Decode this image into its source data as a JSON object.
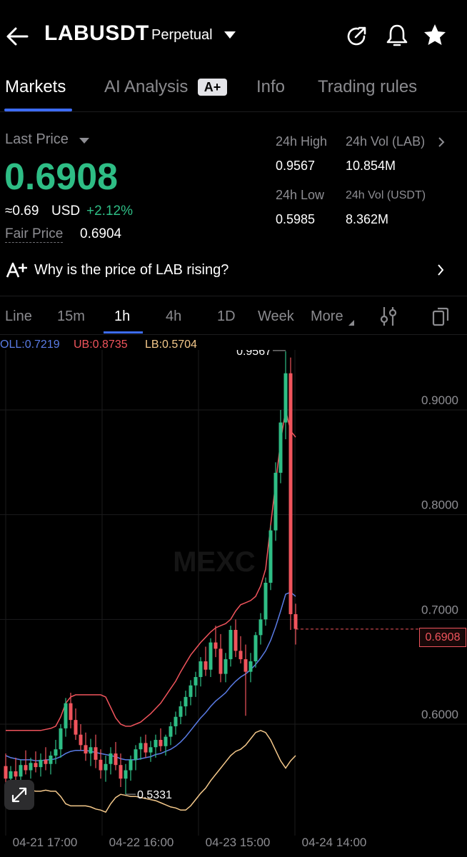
{
  "header": {
    "symbol": "LABUSDT",
    "contract_type": "Perpetual"
  },
  "tabs": [
    {
      "label": "Markets"
    },
    {
      "label": "AI Analysis"
    },
    {
      "label": "Info"
    },
    {
      "label": "Trading rules"
    }
  ],
  "ai_badge": "A+",
  "ticker": {
    "last_price_label": "Last Price",
    "last_price": "0.6908",
    "usd_approx": "≈0.69",
    "usd_unit": "USD",
    "change_pct": "+2.12%",
    "fair_price_label": "Fair Price",
    "fair_price": "0.6904",
    "high_label": "24h High",
    "high": "0.9567",
    "low_label": "24h Low",
    "low": "0.5985",
    "vol_lab_label": "24h Vol (LAB)",
    "vol_lab": "10.854M",
    "vol_usdt_label": "24h Vol (USDT)",
    "vol_usdt": "8.362M"
  },
  "ai_question": "Why is the price of LAB rising?",
  "timeframes": [
    {
      "label": "Line"
    },
    {
      "label": "15m"
    },
    {
      "label": "1h"
    },
    {
      "label": "4h"
    },
    {
      "label": "1D"
    },
    {
      "label": "Week"
    },
    {
      "label": "More"
    }
  ],
  "indicators": {
    "boll": "OLL:0.7219",
    "ub": "UB:0.8735",
    "lb": "LB:0.5704"
  },
  "chart_data": {
    "type": "candlestick",
    "x_ticks": [
      "04-21 17:00",
      "04-22 16:00",
      "04-23 15:00",
      "04-24 14:00"
    ],
    "y_ticks": [
      "0.9000",
      "0.8000",
      "0.7000",
      "0.6000"
    ],
    "ylim": [
      0.5,
      0.97
    ],
    "current_price": "0.6908",
    "max_label": "0.9567",
    "min_label": "0.5331",
    "watermark": "MEXC",
    "candles": [
      {
        "o": 0.56,
        "h": 0.572,
        "l": 0.542,
        "c": 0.548
      },
      {
        "o": 0.548,
        "h": 0.56,
        "l": 0.534,
        "c": 0.555
      },
      {
        "o": 0.555,
        "h": 0.568,
        "l": 0.545,
        "c": 0.55
      },
      {
        "o": 0.55,
        "h": 0.566,
        "l": 0.544,
        "c": 0.561
      },
      {
        "o": 0.561,
        "h": 0.575,
        "l": 0.552,
        "c": 0.556
      },
      {
        "o": 0.556,
        "h": 0.568,
        "l": 0.548,
        "c": 0.563
      },
      {
        "o": 0.563,
        "h": 0.574,
        "l": 0.554,
        "c": 0.559
      },
      {
        "o": 0.559,
        "h": 0.572,
        "l": 0.55,
        "c": 0.566
      },
      {
        "o": 0.566,
        "h": 0.578,
        "l": 0.556,
        "c": 0.562
      },
      {
        "o": 0.562,
        "h": 0.574,
        "l": 0.552,
        "c": 0.57
      },
      {
        "o": 0.57,
        "h": 0.585,
        "l": 0.562,
        "c": 0.576
      },
      {
        "o": 0.576,
        "h": 0.6,
        "l": 0.568,
        "c": 0.596
      },
      {
        "o": 0.596,
        "h": 0.625,
        "l": 0.588,
        "c": 0.62
      },
      {
        "o": 0.62,
        "h": 0.63,
        "l": 0.596,
        "c": 0.604
      },
      {
        "o": 0.604,
        "h": 0.615,
        "l": 0.585,
        "c": 0.59
      },
      {
        "o": 0.59,
        "h": 0.6,
        "l": 0.575,
        "c": 0.58
      },
      {
        "o": 0.58,
        "h": 0.592,
        "l": 0.565,
        "c": 0.572
      },
      {
        "o": 0.572,
        "h": 0.586,
        "l": 0.56,
        "c": 0.578
      },
      {
        "o": 0.578,
        "h": 0.59,
        "l": 0.558,
        "c": 0.566
      },
      {
        "o": 0.566,
        "h": 0.576,
        "l": 0.548,
        "c": 0.556
      },
      {
        "o": 0.556,
        "h": 0.57,
        "l": 0.545,
        "c": 0.562
      },
      {
        "o": 0.562,
        "h": 0.578,
        "l": 0.552,
        "c": 0.572
      },
      {
        "o": 0.572,
        "h": 0.583,
        "l": 0.556,
        "c": 0.561
      },
      {
        "o": 0.561,
        "h": 0.572,
        "l": 0.54,
        "c": 0.548
      },
      {
        "o": 0.548,
        "h": 0.562,
        "l": 0.533,
        "c": 0.556
      },
      {
        "o": 0.556,
        "h": 0.57,
        "l": 0.546,
        "c": 0.566
      },
      {
        "o": 0.566,
        "h": 0.58,
        "l": 0.556,
        "c": 0.576
      },
      {
        "o": 0.576,
        "h": 0.588,
        "l": 0.566,
        "c": 0.582
      },
      {
        "o": 0.582,
        "h": 0.59,
        "l": 0.568,
        "c": 0.573
      },
      {
        "o": 0.573,
        "h": 0.584,
        "l": 0.564,
        "c": 0.578
      },
      {
        "o": 0.578,
        "h": 0.59,
        "l": 0.568,
        "c": 0.585
      },
      {
        "o": 0.585,
        "h": 0.596,
        "l": 0.574,
        "c": 0.579
      },
      {
        "o": 0.579,
        "h": 0.59,
        "l": 0.57,
        "c": 0.588
      },
      {
        "o": 0.588,
        "h": 0.602,
        "l": 0.58,
        "c": 0.598
      },
      {
        "o": 0.598,
        "h": 0.612,
        "l": 0.59,
        "c": 0.607
      },
      {
        "o": 0.607,
        "h": 0.622,
        "l": 0.6,
        "c": 0.617
      },
      {
        "o": 0.617,
        "h": 0.632,
        "l": 0.608,
        "c": 0.626
      },
      {
        "o": 0.626,
        "h": 0.642,
        "l": 0.618,
        "c": 0.637
      },
      {
        "o": 0.637,
        "h": 0.65,
        "l": 0.626,
        "c": 0.645
      },
      {
        "o": 0.645,
        "h": 0.664,
        "l": 0.636,
        "c": 0.66
      },
      {
        "o": 0.66,
        "h": 0.674,
        "l": 0.646,
        "c": 0.652
      },
      {
        "o": 0.652,
        "h": 0.682,
        "l": 0.645,
        "c": 0.678
      },
      {
        "o": 0.678,
        "h": 0.694,
        "l": 0.664,
        "c": 0.672
      },
      {
        "o": 0.672,
        "h": 0.686,
        "l": 0.64,
        "c": 0.648
      },
      {
        "o": 0.648,
        "h": 0.668,
        "l": 0.64,
        "c": 0.662
      },
      {
        "o": 0.662,
        "h": 0.694,
        "l": 0.655,
        "c": 0.69
      },
      {
        "o": 0.69,
        "h": 0.7,
        "l": 0.664,
        "c": 0.67
      },
      {
        "o": 0.67,
        "h": 0.684,
        "l": 0.658,
        "c": 0.662
      },
      {
        "o": 0.662,
        "h": 0.676,
        "l": 0.608,
        "c": 0.65
      },
      {
        "o": 0.65,
        "h": 0.668,
        "l": 0.64,
        "c": 0.66
      },
      {
        "o": 0.66,
        "h": 0.688,
        "l": 0.654,
        "c": 0.685
      },
      {
        "o": 0.685,
        "h": 0.706,
        "l": 0.676,
        "c": 0.7
      },
      {
        "o": 0.7,
        "h": 0.74,
        "l": 0.694,
        "c": 0.735
      },
      {
        "o": 0.735,
        "h": 0.79,
        "l": 0.728,
        "c": 0.785
      },
      {
        "o": 0.785,
        "h": 0.85,
        "l": 0.775,
        "c": 0.84
      },
      {
        "o": 0.84,
        "h": 0.9,
        "l": 0.83,
        "c": 0.888
      },
      {
        "o": 0.888,
        "h": 0.956,
        "l": 0.872,
        "c": 0.935
      },
      {
        "o": 0.935,
        "h": 0.95,
        "l": 0.69,
        "c": 0.705
      },
      {
        "o": 0.705,
        "h": 0.715,
        "l": 0.676,
        "c": 0.691
      }
    ],
    "boll_mid": [
      0.57,
      0.568,
      0.567,
      0.566,
      0.566,
      0.566,
      0.565,
      0.565,
      0.566,
      0.566,
      0.567,
      0.569,
      0.572,
      0.574,
      0.575,
      0.575,
      0.575,
      0.574,
      0.573,
      0.572,
      0.571,
      0.57,
      0.569,
      0.567,
      0.566,
      0.566,
      0.566,
      0.567,
      0.568,
      0.569,
      0.571,
      0.572,
      0.574,
      0.576,
      0.579,
      0.583,
      0.588,
      0.594,
      0.6,
      0.606,
      0.611,
      0.617,
      0.622,
      0.626,
      0.63,
      0.636,
      0.641,
      0.645,
      0.648,
      0.652,
      0.657,
      0.663,
      0.67,
      0.68,
      0.693,
      0.708,
      0.724,
      0.726,
      0.722
    ],
    "boll_ub": [
      0.594,
      0.594,
      0.594,
      0.594,
      0.594,
      0.594,
      0.594,
      0.594,
      0.595,
      0.596,
      0.598,
      0.607,
      0.62,
      0.626,
      0.628,
      0.628,
      0.628,
      0.628,
      0.628,
      0.628,
      0.626,
      0.616,
      0.606,
      0.6,
      0.598,
      0.598,
      0.6,
      0.602,
      0.606,
      0.61,
      0.615,
      0.62,
      0.627,
      0.634,
      0.641,
      0.65,
      0.658,
      0.666,
      0.672,
      0.678,
      0.683,
      0.688,
      0.692,
      0.694,
      0.696,
      0.7,
      0.708,
      0.714,
      0.716,
      0.718,
      0.722,
      0.732,
      0.748,
      0.79,
      0.83,
      0.87,
      0.9,
      0.88,
      0.874
    ],
    "boll_lb": [
      0.545,
      0.542,
      0.54,
      0.538,
      0.537,
      0.537,
      0.536,
      0.536,
      0.537,
      0.536,
      0.536,
      0.531,
      0.524,
      0.522,
      0.522,
      0.522,
      0.522,
      0.521,
      0.519,
      0.518,
      0.516,
      0.524,
      0.53,
      0.533,
      0.532,
      0.531,
      0.531,
      0.53,
      0.529,
      0.528,
      0.527,
      0.525,
      0.523,
      0.521,
      0.52,
      0.518,
      0.518,
      0.522,
      0.528,
      0.534,
      0.539,
      0.546,
      0.552,
      0.558,
      0.564,
      0.57,
      0.574,
      0.576,
      0.58,
      0.586,
      0.592,
      0.594,
      0.592,
      0.585,
      0.575,
      0.565,
      0.558,
      0.565,
      0.57
    ]
  }
}
